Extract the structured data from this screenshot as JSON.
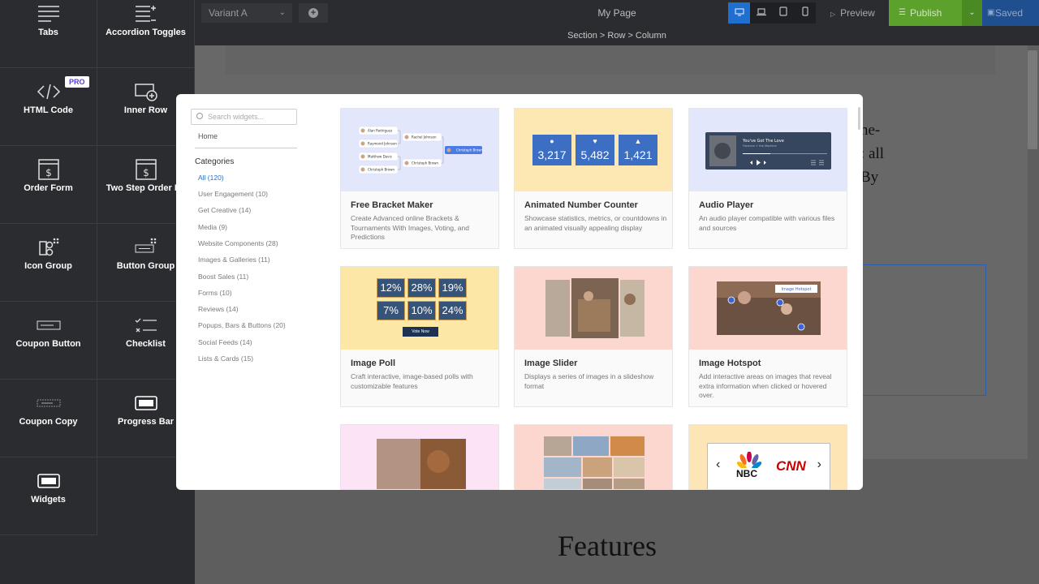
{
  "sidebar": {
    "items": [
      {
        "label": "Tabs",
        "icon": "tabs-icon"
      },
      {
        "label": "Accordion Toggles",
        "icon": "accordion-icon"
      },
      {
        "label": "HTML Code",
        "icon": "code-icon",
        "badge": "PRO"
      },
      {
        "label": "Inner Row",
        "icon": "inner-row-icon"
      },
      {
        "label": "Order Form",
        "icon": "order-form-icon"
      },
      {
        "label": "Two Step Order Fo",
        "icon": "two-step-order-icon"
      },
      {
        "label": "Icon Group",
        "icon": "icon-group-icon"
      },
      {
        "label": "Button Group",
        "icon": "button-group-icon"
      },
      {
        "label": "Coupon Button",
        "icon": "coupon-button-icon"
      },
      {
        "label": "Checklist",
        "icon": "checklist-icon"
      },
      {
        "label": "Coupon Copy",
        "icon": "coupon-copy-icon"
      },
      {
        "label": "Progress Bar",
        "icon": "progress-bar-icon"
      },
      {
        "label": "Widgets",
        "icon": "widgets-icon"
      }
    ]
  },
  "topbar": {
    "variant": "Variant A",
    "page_name": "My Page",
    "preview": "Preview",
    "publish": "Publish",
    "saved": "Saved"
  },
  "breadcrumb": "Section >  Row >  Column",
  "canvas": {
    "right_text": [
      "ne-",
      ": all",
      "By"
    ],
    "features_heading": "Features"
  },
  "modal": {
    "search_placeholder": "Search widgets...",
    "home": "Home",
    "categories_label": "Categories",
    "categories": [
      "All (120)",
      "User Engagement (10)",
      "Get Creative (14)",
      "Media (9)",
      "Website Components (28)",
      "Images & Galleries (11)",
      "Boost Sales (11)",
      "Forms (10)",
      "Reviews (14)",
      "Popups, Bars & Buttons (20)",
      "Social Feeds (14)",
      "Lists & Cards (15)"
    ],
    "cards": [
      {
        "title": "Free Bracket Maker",
        "desc": "Create Advanced online Brackets & Tournaments With Images, Voting, and Predictions"
      },
      {
        "title": "Animated Number Counter",
        "desc": "Showcase statistics, metrics, or countdowns in an animated visually appealing display"
      },
      {
        "title": "Audio Player",
        "desc": "An audio player compatible with various files and sources"
      },
      {
        "title": "Image Poll",
        "desc": "Craft interactive, image-based polls with customizable features"
      },
      {
        "title": "Image Slider",
        "desc": "Displays a series of images in a slideshow format"
      },
      {
        "title": "Image Hotspot",
        "desc": "Add interactive areas on images that reveal extra information when clicked or hovered over."
      }
    ],
    "bracket_names": [
      "Alan Rodriguez",
      "Raymond Johnson",
      "Matthew Davis",
      "Christoph Brown",
      "Rachel Johnson",
      "Christoph Brown",
      "Christoph Brown"
    ],
    "counter_values": [
      "3,217",
      "5,482",
      "1,421"
    ],
    "audio": {
      "track": "You've Got The Love",
      "artist": "Florence + the Machine"
    },
    "poll_values": [
      "12%",
      "28%",
      "19%",
      "7%",
      "10%",
      "24%"
    ],
    "poll_button": "Vote Now",
    "hotspot_tag": "Image Hotspot",
    "logos": [
      "NBC",
      "CNN"
    ]
  }
}
